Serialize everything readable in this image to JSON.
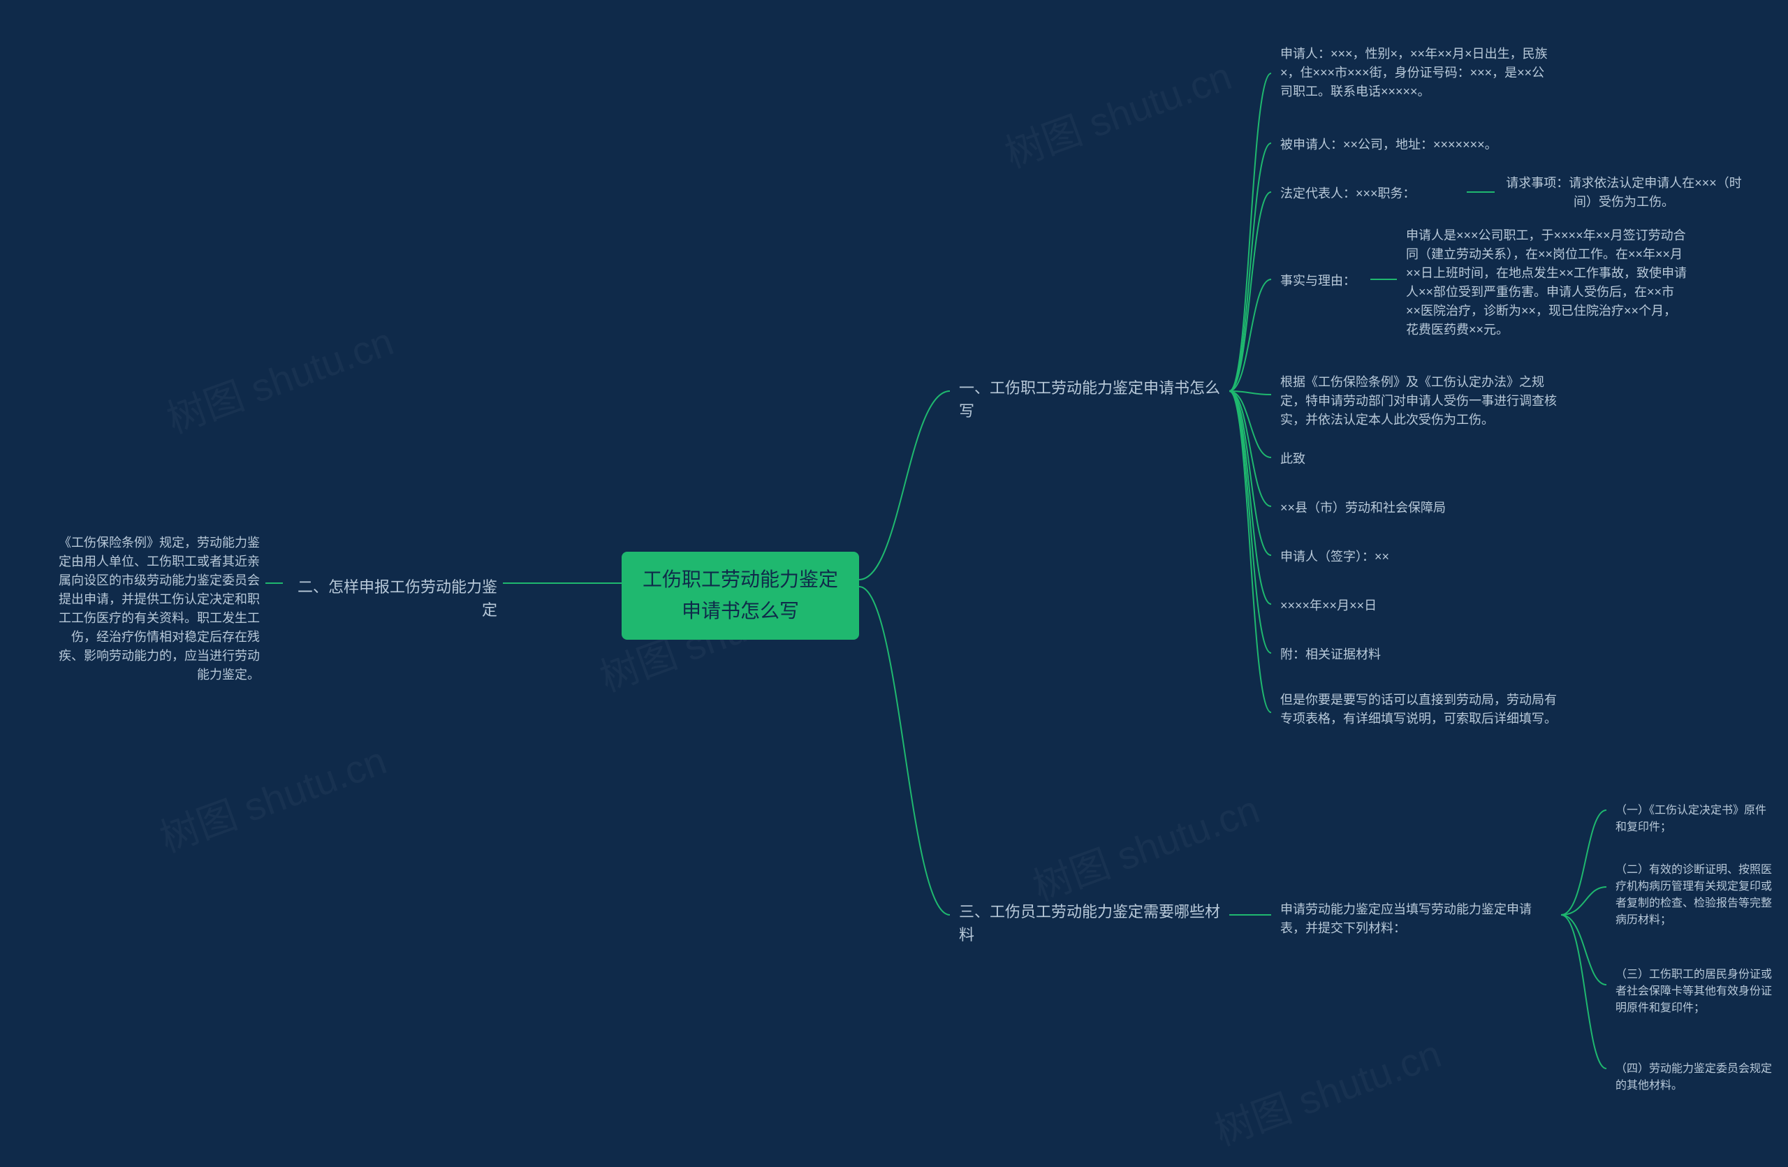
{
  "watermark_text": "树图 shutu.cn",
  "root": "工伤职工劳动能力鉴定申请书怎么写",
  "left": {
    "branch2": {
      "label": "二、怎样申报工伤劳动能力鉴定",
      "detail": "《工伤保险条例》规定，劳动能力鉴定由用人单位、工伤职工或者其近亲属向设区的市级劳动能力鉴定委员会提出申请，并提供工伤认定决定和职工工伤医疗的有关资料。职工发生工伤，经治疗伤情相对稳定后存在残疾、影响劳动能力的，应当进行劳动能力鉴定。"
    }
  },
  "right": {
    "branch1": {
      "label": "一、工伤职工劳动能力鉴定申请书怎么写",
      "items": {
        "applicant": "申请人：×××，性别×，××年××月×日出生，民族×，住×××市×××街，身份证号码：×××，是××公司职工。联系电话×××××。",
        "respondent": "被申请人：××公司，地址：×××××××。",
        "legal_rep_label": "法定代表人：×××职务：",
        "legal_rep_detail": "请求事项：请求依法认定申请人在×××（时间）受伤为工伤。",
        "facts_label": "事实与理由：",
        "facts_detail": "申请人是×××公司职工，于××××年××月签订劳动合同（建立劳动关系），在××岗位工作。在××年××月××日上班时间，在地点发生××工作事故，致使申请人××部位受到严重伤害。申请人受伤后，在××市××医院治疗，诊断为××，现已住院治疗××个月，花费医药费××元。",
        "basis": "根据《工伤保险条例》及《工伤认定办法》之规定，特申请劳动部门对申请人受伤一事进行调查核实，并依法认定本人此次受伤为工伤。",
        "closing": "此致",
        "bureau": "××县（市）劳动和社会保障局",
        "signer": "申请人（签字）：××",
        "date": "××××年××月××日",
        "attach": "附：相关证据材料",
        "note": "但是你要是要写的话可以直接到劳动局，劳动局有专项表格，有详细填写说明，可索取后详细填写。"
      }
    },
    "branch3": {
      "label": "三、工伤员工劳动能力鉴定需要哪些材料",
      "intro": "申请劳动能力鉴定应当填写劳动能力鉴定申请表，并提交下列材料：",
      "items": {
        "m1": "（一）《工伤认定决定书》原件和复印件；",
        "m2": "（二）有效的诊断证明、按照医疗机构病历管理有关规定复印或者复制的检查、检验报告等完整病历材料；",
        "m3": "（三）工伤职工的居民身份证或者社会保障卡等其他有效身份证明原件和复印件；",
        "m4": "（四）劳动能力鉴定委员会规定的其他材料。"
      }
    }
  }
}
